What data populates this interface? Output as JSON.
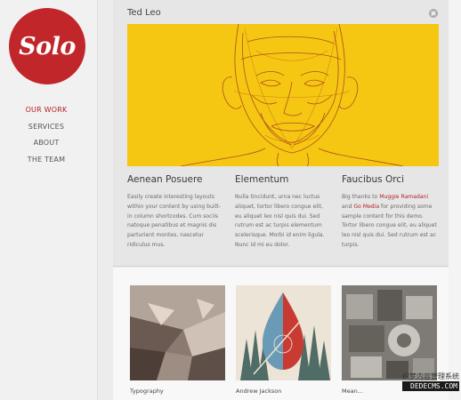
{
  "brand": {
    "logo_text": "Solo",
    "accent": "#c0262a"
  },
  "nav": {
    "items": [
      {
        "label": "OUR WORK",
        "active": true
      },
      {
        "label": "SERVICES",
        "active": false
      },
      {
        "label": "ABOUT",
        "active": false
      },
      {
        "label": "THE TEAM",
        "active": false
      }
    ]
  },
  "feature": {
    "title": "Ted Leo",
    "close_icon": "close-icon",
    "hero_icon": "portrait-illustration",
    "columns": [
      {
        "heading": "Aenean Posuere",
        "text": "Easily create interesting layouts within your content by using built-in column shortcodes. Cum sociis natoque penatibus et magnis dis parturient montes, nascetur ridiculus mus."
      },
      {
        "heading": "Elementum",
        "text": "Nulla tincidunt, urna nec luctus aliquet, tortor libero congue elit, eu aliquet leo nisl quis dui. Sed rutrum est ac turpis elementum scelerisque. Morbi id enim ligula. Nunc id mi eu dolor."
      },
      {
        "heading": "Faucibus Orci",
        "text_before": "Big thanks to ",
        "link1": "Muggie Ramadani",
        "text_mid": " and ",
        "link2": "Go Media",
        "text_after": " for providing some sample content for this demo. Tortor libero congue elit, eu aliquet leo nisl quis dui. Sed rutrum est ac turpis."
      }
    ]
  },
  "portfolio": {
    "items": [
      {
        "label": "Typography"
      },
      {
        "label": "Andrew Jackson"
      },
      {
        "label": "Mean..."
      }
    ]
  },
  "watermark": {
    "line1": "织梦内容管理系统",
    "line2": "DEDECMS.COM"
  }
}
